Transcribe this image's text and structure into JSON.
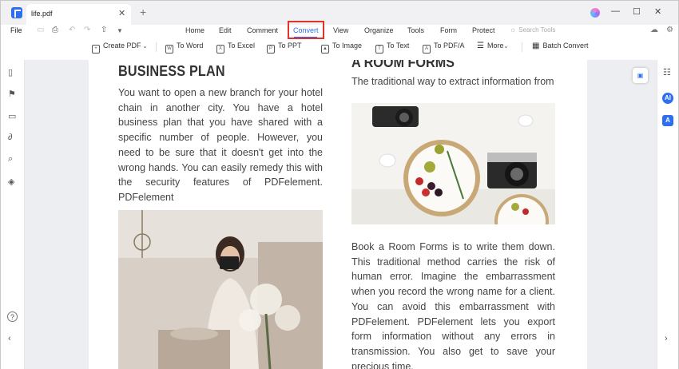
{
  "titlebar": {
    "tab_label": "life.pdf",
    "tab_close": "✕",
    "new_tab": "+",
    "minimize": "—",
    "maximize": "☐",
    "close": "✕"
  },
  "menubar": {
    "file_label": "File",
    "items": [
      {
        "label": "Home"
      },
      {
        "label": "Edit"
      },
      {
        "label": "Comment"
      },
      {
        "label": "Convert",
        "active": true
      },
      {
        "label": "View"
      },
      {
        "label": "Organize"
      },
      {
        "label": "Tools"
      },
      {
        "label": "Form"
      },
      {
        "label": "Protect"
      }
    ],
    "search_placeholder": "Search Tools"
  },
  "toolbar": {
    "create_pdf": "Create PDF",
    "to_word": "To Word",
    "to_excel": "To Excel",
    "to_ppt": "To PPT",
    "to_image": "To Image",
    "to_text": "To Text",
    "to_pdfa": "To PDF/A",
    "more": "More",
    "batch_convert": "Batch Convert"
  },
  "document": {
    "left_heading": "BUSINESS PLAN",
    "left_body": "You want to open a new branch for your hotel chain in another city. You have a hotel business plan that you have shared with a specific number of people. However, you need to be sure that it doesn't get into the wrong hands. You can easily remedy this with the security features of PDFelement. PDFelement",
    "right_heading": "A ROOM FORMS",
    "right_subtitle": "The traditional way to extract information from",
    "right_body": "Book a Room Forms is to write them down. This traditional method carries the risk of human error. Imagine the embarrassment when you record the wrong name for a client. You can avoid this embarrassment with PDFelement. PDFelement lets you export form information without any errors in transmission. You also get to save your precious time."
  },
  "right_sidebar": {
    "ai_label": "AI",
    "translate_label": "A"
  },
  "colors": {
    "accent": "#2e6ff2",
    "highlight_box": "#e0342b",
    "canvas_bg": "#eceef1"
  },
  "icons": [
    "app-logo-icon",
    "print-icon",
    "undo-icon",
    "redo-icon",
    "share-icon",
    "bulb-icon",
    "cloud-icon",
    "settings-icon",
    "page-thumbnail-icon",
    "bookmark-icon",
    "comment-icon",
    "attachment-icon",
    "search-icon",
    "layers-icon",
    "help-icon",
    "collapse-icon"
  ]
}
